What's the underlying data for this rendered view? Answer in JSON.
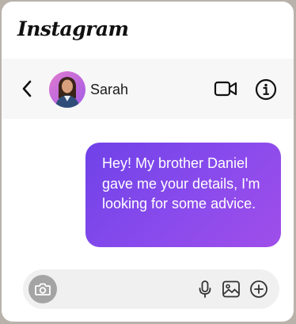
{
  "app": {
    "brand": "Instagram"
  },
  "chat": {
    "contact_name": "Sarah",
    "icons": {
      "back": "chevron-left-icon",
      "video": "video-camera-icon",
      "info": "info-circle-icon"
    }
  },
  "messages": [
    {
      "direction": "outgoing",
      "text": "Hey! My brother Daniel gave me your details, I'm looking for some advice."
    }
  ],
  "composer": {
    "value": "",
    "icons": [
      "camera-icon",
      "microphone-icon",
      "image-icon",
      "plus-circle-icon"
    ]
  },
  "colors": {
    "bubble_start": "#6f42e8",
    "bubble_end": "#a04ee9",
    "camera_button": "#a4a4a4",
    "header_background": "#f7f7f7",
    "composer_background": "#f0f0f0"
  }
}
